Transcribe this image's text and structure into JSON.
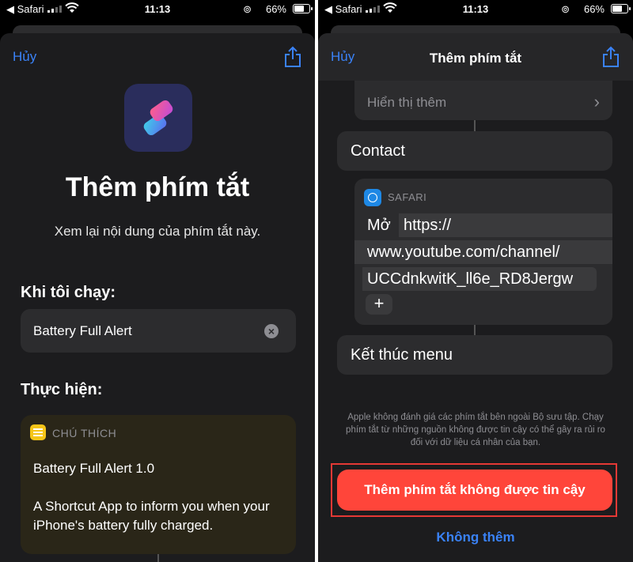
{
  "status_bar": {
    "back_label": "◀ Safari",
    "time": "11:13",
    "battery_percent": "66%",
    "signal_bars": 2,
    "icons": [
      "signal-icon",
      "wifi-icon",
      "rotation-lock-icon",
      "battery-icon"
    ]
  },
  "left": {
    "cancel_label": "Hủy",
    "title": "Thêm phím tắt",
    "subtitle": "Xem lại nội dung của phím tắt này.",
    "when_run_label": "Khi tôi chạy:",
    "shortcut_name": "Battery Full Alert",
    "actions_label": "Thực hiện:",
    "comment": {
      "label": "CHÚ THÍCH",
      "title": "Battery Full Alert 1.0",
      "body": "A Shortcut App to inform you when your iPhone's  battery fully charged."
    }
  },
  "right": {
    "cancel_label": "Hủy",
    "nav_title": "Thêm phím tắt",
    "show_more_label": "Hiển thị thêm",
    "contact_label": "Contact",
    "safari_action": {
      "app_label": "SAFARI",
      "open_label": "Mở",
      "url_line1": "https://",
      "url_line2": "www.youtube.com/channel/",
      "url_line3": "UCCdnkwitK_ll6e_RD8Jergw",
      "add_symbol": "+"
    },
    "end_menu_label": "Kết thúc menu",
    "warning_text": "Apple không đánh giá các phím tắt bên ngoài Bộ sưu tập. Chạy phím tắt từ những nguồn không được tin cậy có thể gây ra rủi ro đối với dữ liệu cá nhân của bạn.",
    "add_untrusted_label": "Thêm phím tắt không được tin cậy",
    "dont_add_label": "Không thêm"
  },
  "colors": {
    "accent_blue": "#3a82f7",
    "destructive_red": "#ff453a",
    "highlight_box": "#e53935",
    "note_yellow": "#f5c518"
  }
}
